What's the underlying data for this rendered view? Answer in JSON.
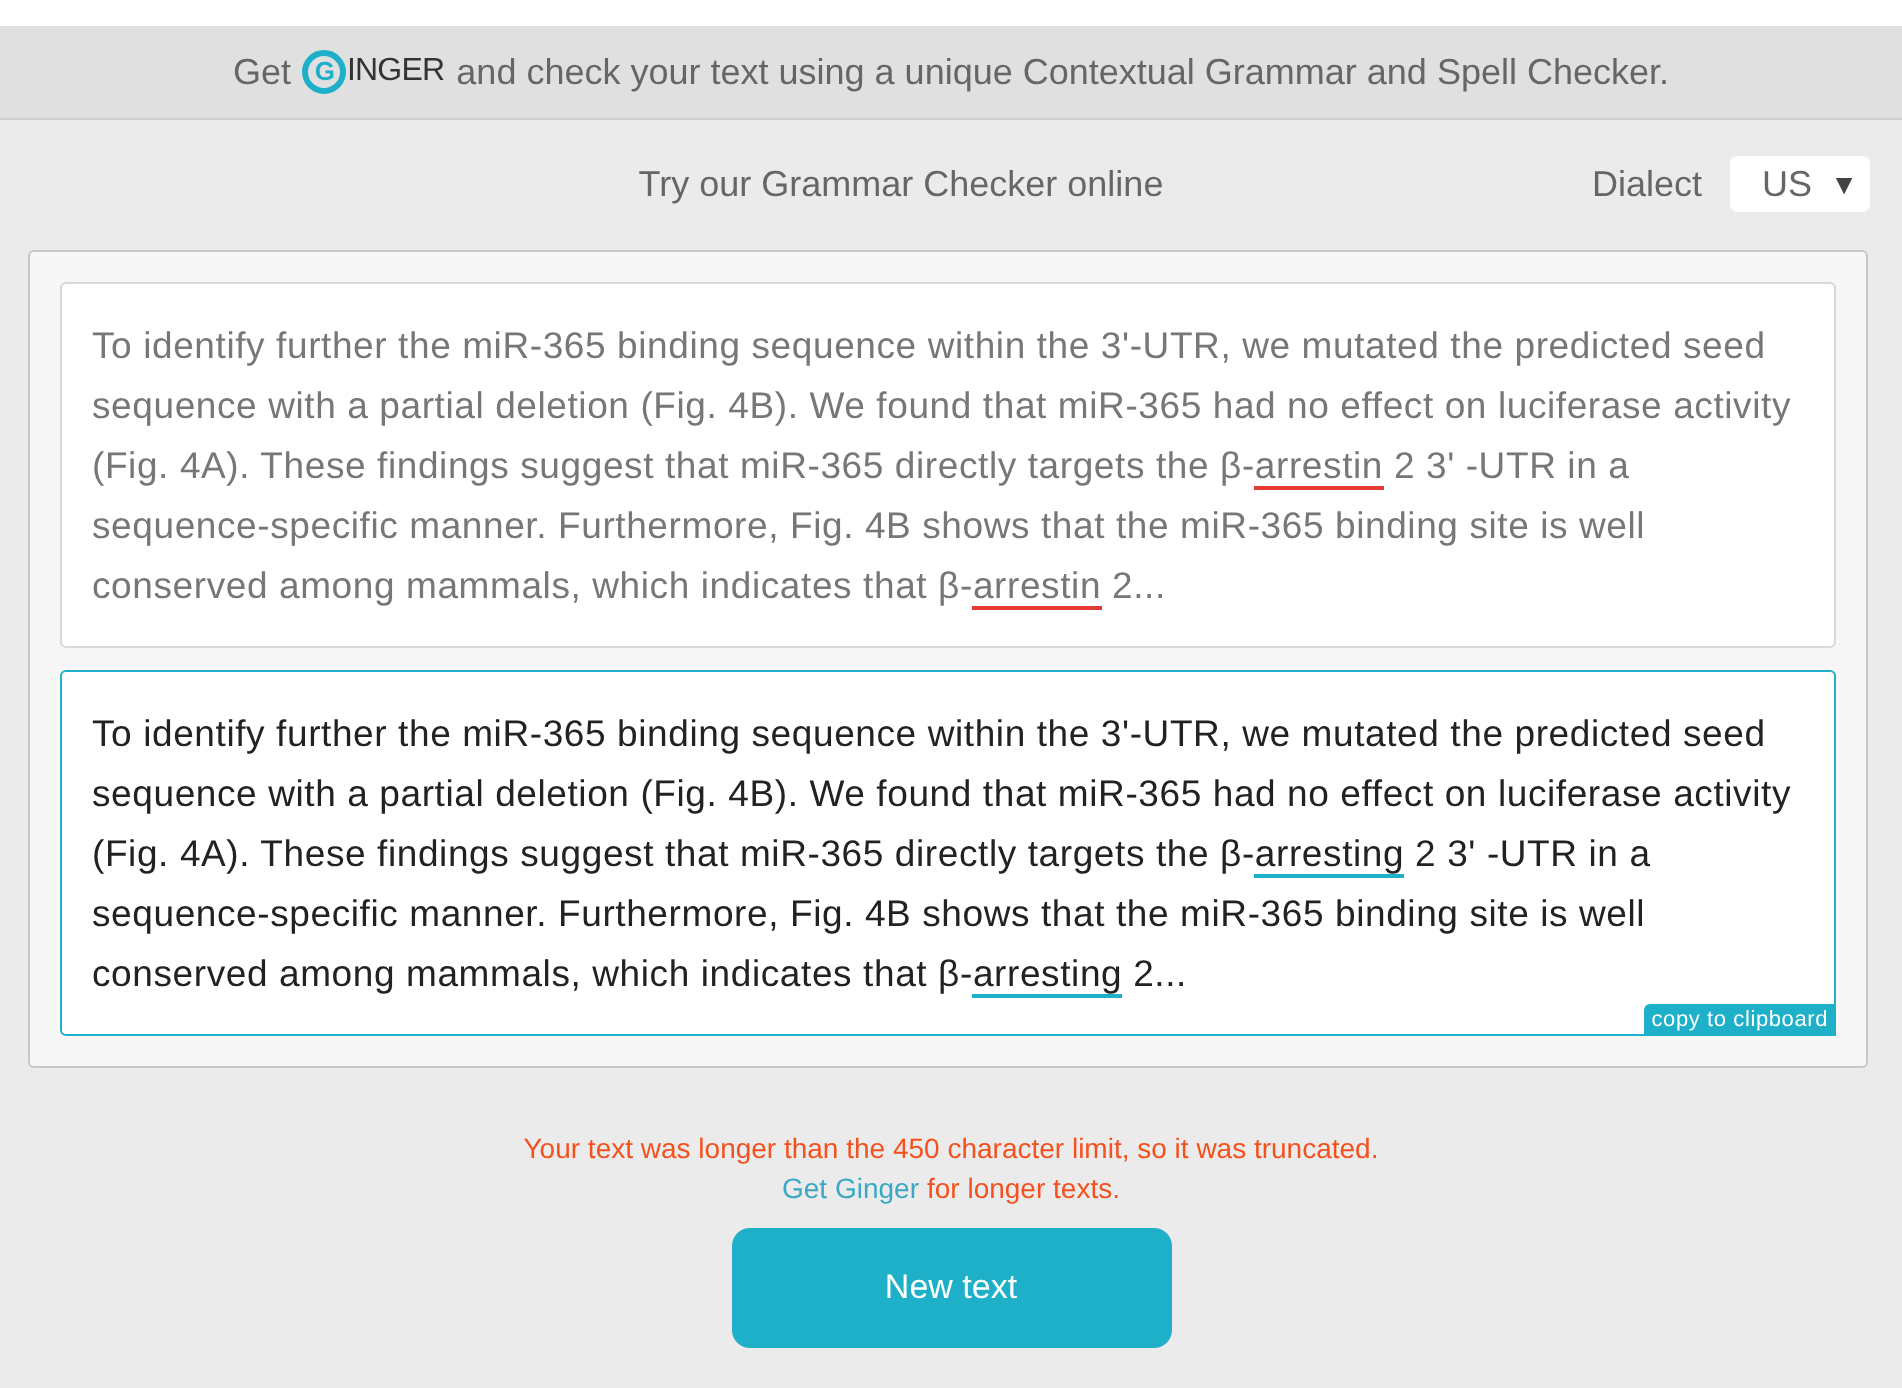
{
  "banner": {
    "before": "Get",
    "logo": {
      "initial": "G",
      "rest": "INGER"
    },
    "after": "and check your text using a unique Contextual Grammar and Spell Checker."
  },
  "heading": "Try our Grammar Checker online",
  "dialect": {
    "label": "Dialect",
    "value": "US",
    "caret": "▼"
  },
  "original": {
    "segments": [
      {
        "kind": "plain",
        "text": "To identify further the miR-365 binding sequence within the 3'-UTR, we mutated the predicted seed sequence with a partial deletion (Fig. 4B). We found that miR-365 had no effect on luciferase activity (Fig. 4A). These findings suggest that miR-365 directly targets the β-"
      },
      {
        "kind": "error",
        "text": "arrestin"
      },
      {
        "kind": "plain",
        "text": " 2 3' -UTR in a sequence-specific manner. Furthermore, Fig. 4B shows that the miR-365 binding site is well conserved among mammals, which indicates that β-"
      },
      {
        "kind": "error",
        "text": "arrestin"
      },
      {
        "kind": "plain",
        "text": " 2..."
      }
    ]
  },
  "corrected": {
    "segments": [
      {
        "kind": "plain",
        "text": "To identify further the miR-365 binding sequence within the 3'-UTR, we mutated the predicted seed sequence with a partial deletion (Fig. 4B). We found that miR-365 had no effect on luciferase activity (Fig. 4A). These findings suggest that miR-365 directly targets the β-"
      },
      {
        "kind": "fix",
        "text": "arresting"
      },
      {
        "kind": "plain",
        "text": " 2 3' -UTR in a sequence-specific manner. Furthermore, Fig. 4B shows that the miR-365 binding site is well conserved among mammals, which indicates that β-"
      },
      {
        "kind": "fix",
        "text": "arresting"
      },
      {
        "kind": "plain",
        "text": " 2..."
      }
    ],
    "copy_button": "copy to clipboard"
  },
  "warning": "Your text was longer than the 450 character limit, so it was truncated.",
  "promo": {
    "link": "Get Ginger",
    "text": "for longer texts."
  },
  "new_text_button": "New text"
}
